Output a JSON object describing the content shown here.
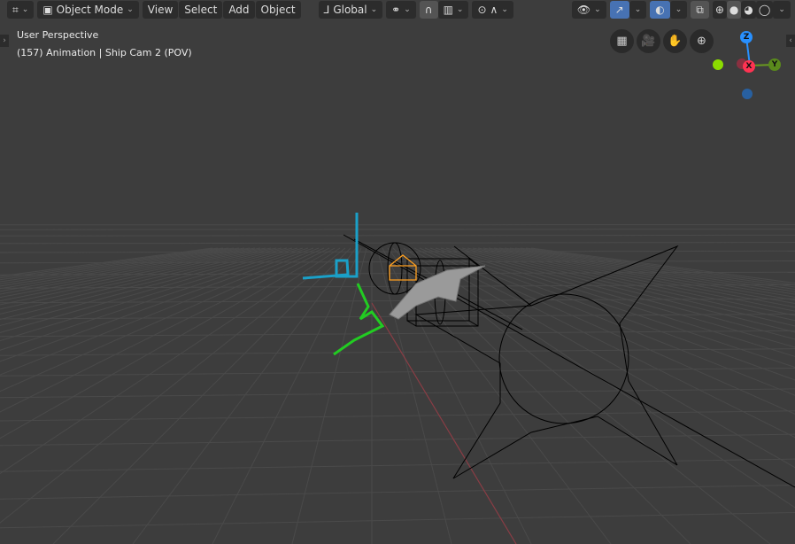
{
  "header": {
    "editor_type_icon": "3d-viewport-icon",
    "mode": "Object Mode",
    "menus": [
      "View",
      "Select",
      "Add",
      "Object"
    ],
    "transform_orientation": "Global",
    "shading_modes": [
      "wireframe",
      "solid",
      "material-preview",
      "rendered"
    ],
    "active_shading": "solid",
    "accent_color": "#4772b3"
  },
  "overlay": {
    "view_name": "User Perspective",
    "object_info": "(157) Animation | Ship Cam 2 (POV)"
  },
  "nav": {
    "icons": [
      "grid-toggle-icon",
      "camera-view-icon",
      "pan-hand-icon",
      "zoom-icon"
    ]
  },
  "gizmo": {
    "z": "Z",
    "x": "X",
    "y": "Y",
    "colors": {
      "x": "#ff3352",
      "y": "#8bdc00",
      "z": "#2890ff"
    }
  }
}
